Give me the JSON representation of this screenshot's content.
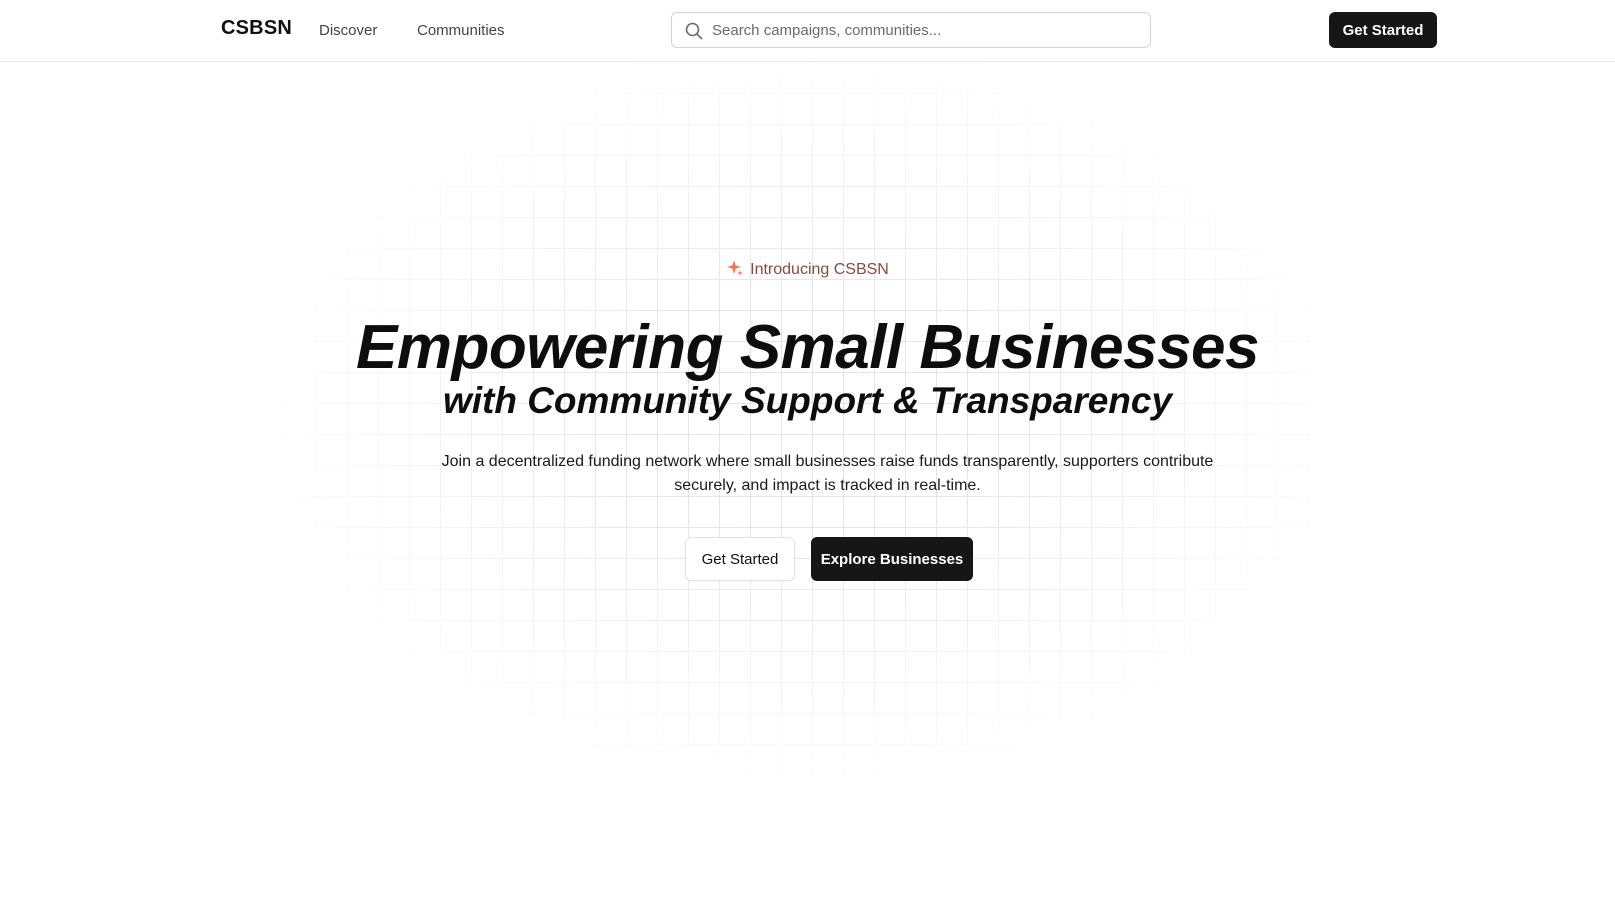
{
  "nav": {
    "brand": "CSBSN",
    "links": [
      "Discover",
      "Communities"
    ],
    "search_placeholder": "Search campaigns, communities...",
    "cta": "Get Started"
  },
  "hero": {
    "badge": "Introducing CSBSN",
    "headline": "Empowering Small Businesses",
    "subheadline": "with Community Support & Transparency",
    "description": "Join a decentralized funding network where small businesses raise funds transparently, supporters contribute securely, and impact is tracked in real-time.",
    "buttons": {
      "secondary": "Get Started",
      "primary": "Explore Businesses"
    }
  },
  "colors": {
    "accent": "#f97352",
    "badge_text": "#8a4b3e",
    "button_dark": "#161616",
    "grid_line": "#e4e4e7"
  },
  "icons": {
    "search": "search-icon",
    "badge": "sparkles-icon"
  }
}
